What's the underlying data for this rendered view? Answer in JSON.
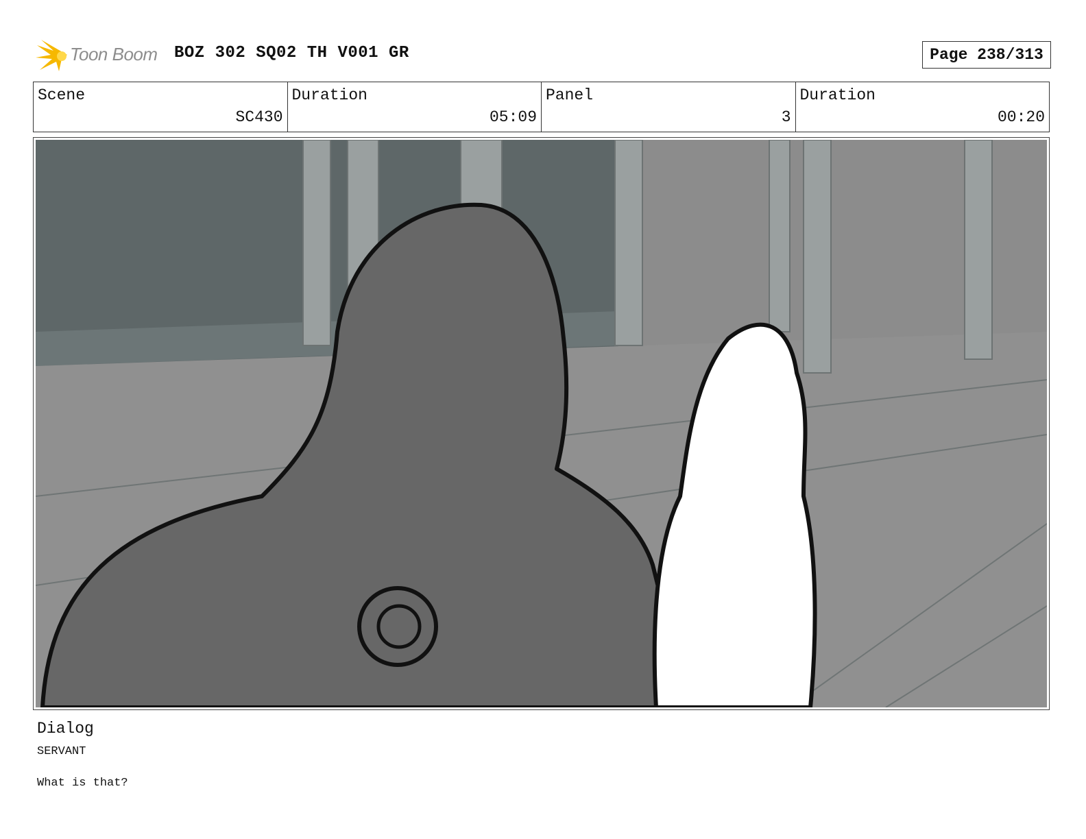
{
  "header": {
    "logo_text": "Toon Boom",
    "title": "BOZ 302 SQ02 TH V001 GR",
    "page": "Page 238/313"
  },
  "info": [
    {
      "label": "Scene",
      "value": "SC430"
    },
    {
      "label": "Duration",
      "value": "05:09"
    },
    {
      "label": "Panel",
      "value": "3"
    },
    {
      "label": "Duration",
      "value": "00:20"
    }
  ],
  "panel": {
    "icon": "storyboard-panel-image",
    "colors": {
      "background": "#8a8a8a",
      "character_fill": "#666666",
      "line": "#111111"
    }
  },
  "dialog": {
    "label": "Dialog",
    "speaker": "SERVANT",
    "line": "What is that?"
  },
  "colors": {
    "logo": "#f6b800",
    "logo_text": "#8d8d8d"
  }
}
